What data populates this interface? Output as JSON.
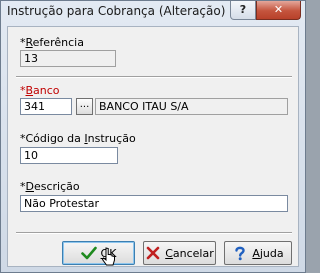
{
  "window": {
    "title": "Instrução para Cobrança (Alteração)",
    "help_glyph": "?",
    "close_glyph": "✕"
  },
  "fields": {
    "referencia": {
      "asterisk": "*",
      "label_u": "R",
      "label_rest": "eferência",
      "value": "13"
    },
    "banco": {
      "asterisk": "*",
      "label_u": "B",
      "label_rest": "anco",
      "code": "341",
      "lookup_label": "...",
      "name": "BANCO ITAU S/A"
    },
    "codigo": {
      "asterisk": "*",
      "label_pre": "Código da ",
      "label_u": "I",
      "label_rest": "nstrução",
      "value": "10"
    },
    "descricao": {
      "asterisk": "*",
      "label_u": "D",
      "label_rest": "escrição",
      "value": "Não Protestar"
    }
  },
  "buttons": {
    "ok": {
      "label_u": "O",
      "label_rest": "K"
    },
    "cancel": {
      "label_u": "C",
      "label_rest": "ancelar"
    },
    "help": {
      "label_u": "A",
      "label_rest": "juda"
    }
  },
  "colors": {
    "required_label": "#c00000",
    "ok_check": "#1f8a1f",
    "cancel_x": "#c02020",
    "help_icon": "#2060c0"
  }
}
